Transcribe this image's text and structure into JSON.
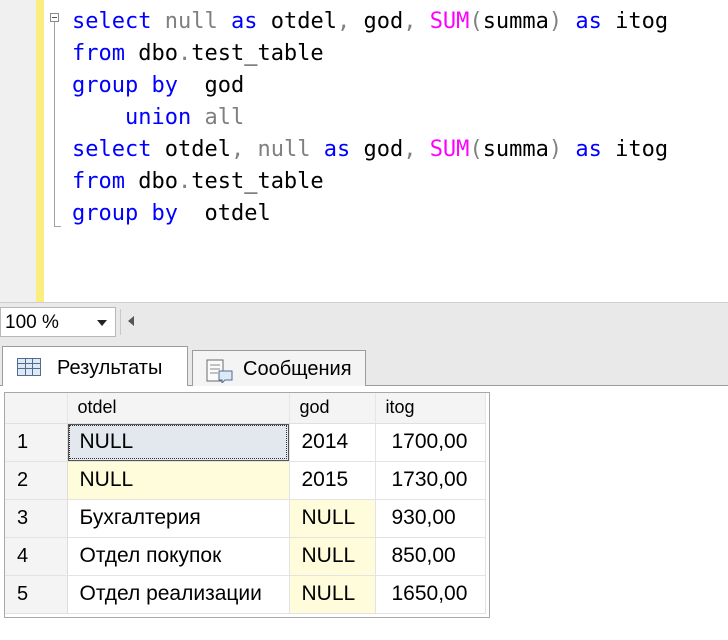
{
  "editor": {
    "lines": [
      [
        {
          "t": "select",
          "c": "kw"
        },
        {
          "t": " null ",
          "c": "gy"
        },
        {
          "t": "as",
          "c": "kw"
        },
        {
          "t": " otdel",
          "c": "pl"
        },
        {
          "t": ",",
          "c": "gy"
        },
        {
          "t": " god",
          "c": "pl"
        },
        {
          "t": ",",
          "c": "gy"
        },
        {
          "t": " ",
          "c": "pl"
        },
        {
          "t": "SUM",
          "c": "fn"
        },
        {
          "t": "(",
          "c": "gy"
        },
        {
          "t": "summa",
          "c": "pl"
        },
        {
          "t": ")",
          "c": "gy"
        },
        {
          "t": " ",
          "c": "pl"
        },
        {
          "t": "as",
          "c": "kw"
        },
        {
          "t": " itog",
          "c": "pl"
        }
      ],
      [
        {
          "t": "from",
          "c": "kw"
        },
        {
          "t": " dbo",
          "c": "pl"
        },
        {
          "t": ".",
          "c": "gy"
        },
        {
          "t": "test_table",
          "c": "pl"
        }
      ],
      [
        {
          "t": "group by",
          "c": "kw"
        },
        {
          "t": "  god",
          "c": "pl"
        }
      ],
      [
        {
          "t": "    ",
          "c": "pl"
        },
        {
          "t": "union",
          "c": "kw"
        },
        {
          "t": " all",
          "c": "gy"
        }
      ],
      [
        {
          "t": "select",
          "c": "kw"
        },
        {
          "t": " otdel",
          "c": "pl"
        },
        {
          "t": ",",
          "c": "gy"
        },
        {
          "t": " null ",
          "c": "gy"
        },
        {
          "t": "as",
          "c": "kw"
        },
        {
          "t": " god",
          "c": "pl"
        },
        {
          "t": ",",
          "c": "gy"
        },
        {
          "t": " ",
          "c": "pl"
        },
        {
          "t": "SUM",
          "c": "fn"
        },
        {
          "t": "(",
          "c": "gy"
        },
        {
          "t": "summa",
          "c": "pl"
        },
        {
          "t": ")",
          "c": "gy"
        },
        {
          "t": " ",
          "c": "pl"
        },
        {
          "t": "as",
          "c": "kw"
        },
        {
          "t": " itog",
          "c": "pl"
        }
      ],
      [
        {
          "t": "from",
          "c": "kw"
        },
        {
          "t": " dbo",
          "c": "pl"
        },
        {
          "t": ".",
          "c": "gy"
        },
        {
          "t": "test_table",
          "c": "pl"
        }
      ],
      [
        {
          "t": "group by",
          "c": "kw"
        },
        {
          "t": "  otdel",
          "c": "pl"
        }
      ]
    ],
    "colors": {
      "keyword": "#0000ff",
      "function": "#ff00ff",
      "operator": "#808080",
      "gutter": "#fbee80"
    }
  },
  "zoom": {
    "value": "100 %"
  },
  "tabs": {
    "results_label": "Результаты",
    "messages_label": "Сообщения"
  },
  "grid": {
    "columns": [
      "otdel",
      "god",
      "itog"
    ],
    "rows": [
      {
        "num": "1",
        "otdel": "NULL",
        "god": "2014",
        "itog": "1700,00"
      },
      {
        "num": "2",
        "otdel": "NULL",
        "god": "2015",
        "itog": "1730,00"
      },
      {
        "num": "3",
        "otdel": "Бухгалтерия",
        "god": "NULL",
        "itog": "930,00"
      },
      {
        "num": "4",
        "otdel": "Отдел покупок",
        "god": "NULL",
        "itog": "850,00"
      },
      {
        "num": "5",
        "otdel": "Отдел реализации",
        "god": "NULL",
        "itog": "1650,00"
      }
    ]
  }
}
